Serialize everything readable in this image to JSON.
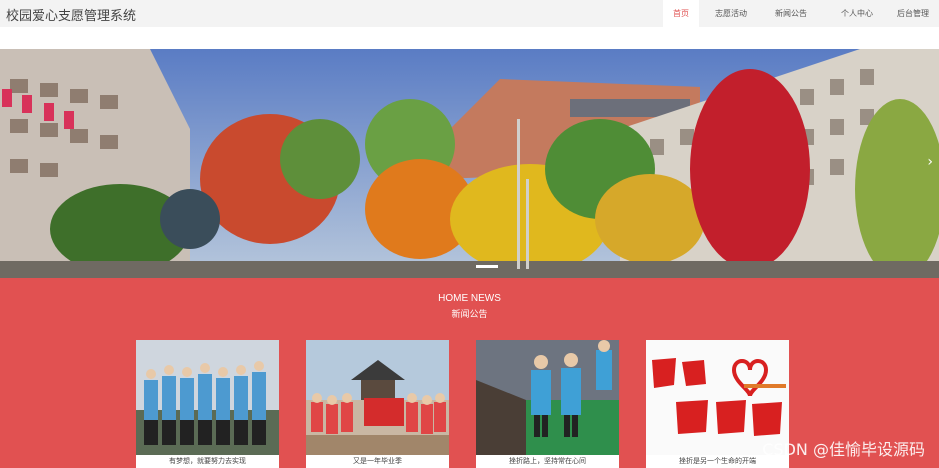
{
  "header": {
    "site_title": "校园爱心支愿管理系统",
    "nav": [
      {
        "label": "首页",
        "active": true
      },
      {
        "label": "志愿活动",
        "active": false
      },
      {
        "label": "新闻公告",
        "active": false
      },
      {
        "label": "个人中心",
        "active": false
      },
      {
        "label": "后台管理",
        "active": false
      }
    ]
  },
  "carousel": {
    "next_icon": "chevron-right-icon",
    "next_glyph": "›"
  },
  "news": {
    "title_en": "HOME NEWS",
    "title_cn": "新闻公告",
    "items": [
      {
        "caption": "有梦想，就要努力去实现"
      },
      {
        "caption": "又是一年毕业季"
      },
      {
        "caption": "挫折路上，坚持常在心间"
      },
      {
        "caption": "挫折是另一个生命的开端"
      }
    ]
  },
  "watermark": "CSDN @佳愉毕设源码",
  "colors": {
    "accent": "#e15151",
    "topbar": "#f3f3f3",
    "active_nav_text": "#e05252"
  }
}
